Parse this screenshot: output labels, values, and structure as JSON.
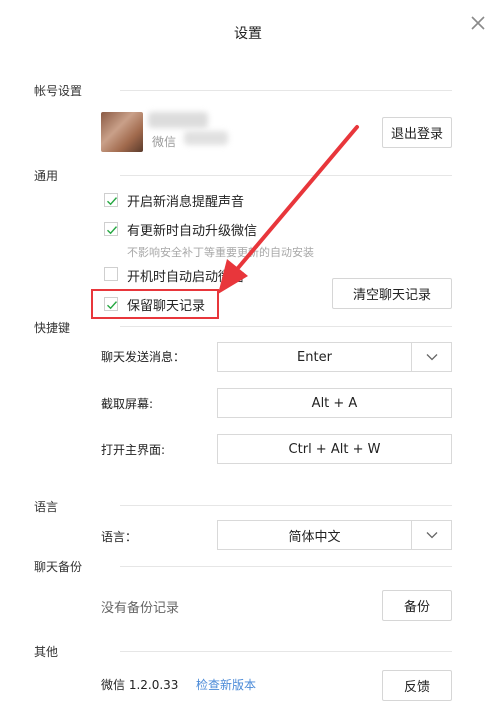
{
  "window": {
    "title": "设置"
  },
  "sections": {
    "account": "帐号设置",
    "general": "通用",
    "shortcuts": "快捷键",
    "language": "语言",
    "backup": "聊天备份",
    "other": "其他"
  },
  "account": {
    "wx_label": "微信",
    "logout_label": "退出登录"
  },
  "general": {
    "options": [
      {
        "label": "开启新消息提醒声音",
        "checked": true
      },
      {
        "label": "有更新时自动升级微信",
        "checked": true
      },
      {
        "label": "开机时自动启动微信",
        "checked": false
      },
      {
        "label": "保留聊天记录",
        "checked": true
      }
    ],
    "update_hint": "不影响安全补丁等重要更新的自动安装",
    "clear_history_label": "清空聊天记录"
  },
  "shortcuts": {
    "send_label": "聊天发送消息：",
    "send_value": "Enter",
    "screenshot_label": "截取屏幕:",
    "screenshot_value": "Alt + A",
    "open_main_label": "打开主界面:",
    "open_main_value": "Ctrl + Alt + W"
  },
  "language": {
    "label": "语言：",
    "value": "简体中文"
  },
  "backup": {
    "status": "没有备份记录",
    "backup_label": "备份"
  },
  "other": {
    "version_label": "微信 1.2.0.33",
    "update_link": "检查新版本",
    "feedback_label": "反馈"
  },
  "colors": {
    "check": "#27a843",
    "annotation": "#e8363b",
    "link": "#4a8ad8"
  }
}
